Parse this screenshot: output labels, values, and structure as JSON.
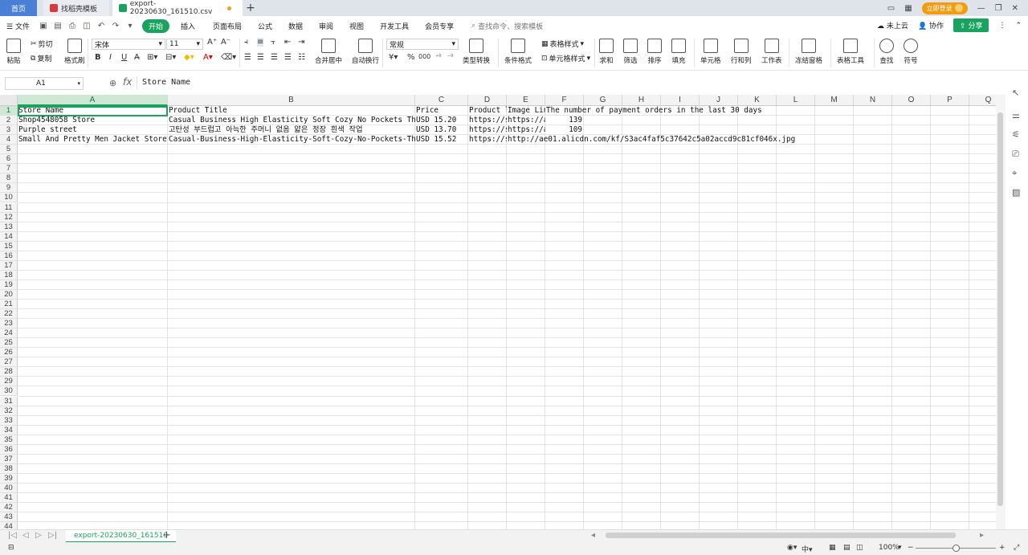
{
  "tabs": {
    "home": "首页",
    "t1": "找稻壳模板",
    "t2": "export-20230630_161510.csv"
  },
  "titlebar": {
    "login": "立即登录"
  },
  "menu": {
    "file": "文件",
    "items": [
      "开始",
      "插入",
      "页面布局",
      "公式",
      "数据",
      "审阅",
      "视图",
      "开发工具",
      "会员专享"
    ],
    "search": "查找命令、搜索模板",
    "right": [
      "未上云",
      "协作",
      "分享"
    ]
  },
  "ribbon": {
    "paste": "粘贴",
    "cut": "剪切",
    "copy": "复制",
    "format_painter": "格式刷",
    "font": "宋体",
    "size": "11",
    "merge": "合并居中",
    "wrap": "自动换行",
    "numfmt": "常规",
    "convert": "类型转换",
    "cond": "条件格式",
    "table_style": "表格样式",
    "cell_style": "单元格样式",
    "sum": "求和",
    "filter": "筛选",
    "sort": "排序",
    "fill": "填充",
    "cells": "单元格",
    "rowcol": "行和列",
    "sheet": "工作表",
    "freeze": "冻结窗格",
    "tools": "表格工具",
    "find": "查找",
    "symbol": "符号"
  },
  "formula": {
    "namebox": "A1",
    "fx": "fx",
    "content": "Store Name"
  },
  "columns": [
    "A",
    "B",
    "C",
    "D",
    "E",
    "F",
    "G",
    "H",
    "I",
    "J",
    "K",
    "L",
    "M",
    "N",
    "O",
    "P",
    "Q"
  ],
  "rows": [
    {
      "a": "Store Name",
      "b": "Product Title",
      "c": "Price",
      "d": "Product l",
      "e": "Image Lin",
      "f": "The number of payment orders in the last 30 days"
    },
    {
      "a": "Shop4548058 Store",
      "b": "Casual Business High Elasticity Soft Cozy No Pockets Thin",
      "c": "USD  15.20",
      "d": "https://s",
      "e": "https://a",
      "f": "139"
    },
    {
      "a": "Purple street",
      "b": "고탄성 부드럽고 아늑한 주머니 없음 얇은 정장 흰색 작업",
      "c": "USD  13.70",
      "d": "https://s",
      "e": "https://a",
      "f": "109"
    },
    {
      "a": "Small And Pretty Men Jacket Store",
      "b": "Casual-Business-High-Elasticity-Soft-Cozy-No-Pockets-Thin-",
      "c": "USD  15.52",
      "d": "https://s",
      "e": "http://ae01.alicdn.com/kf/S3ac4faf5c37642c5a02accd9c81cf046x.jpg",
      "f": ""
    }
  ],
  "sheet": {
    "name": "export-20230630_161510"
  },
  "status": {
    "zoom": "100%"
  },
  "colors": {
    "accent": "#1aa35f",
    "home_tab": "#4a7fd6"
  }
}
